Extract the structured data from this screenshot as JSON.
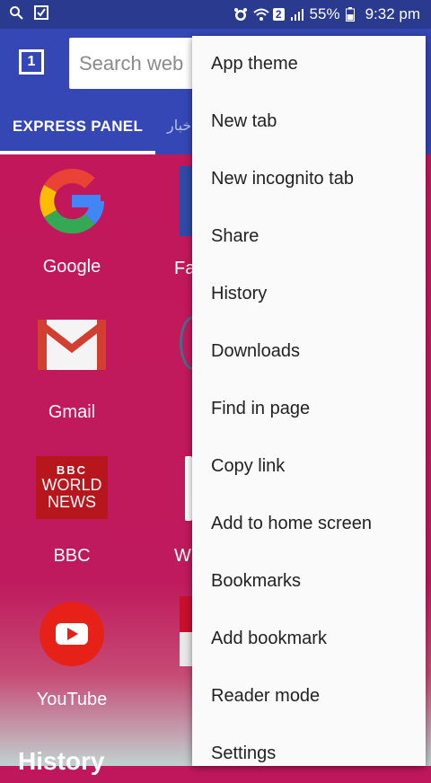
{
  "status_bar": {
    "battery": "55%",
    "time": "9:32 pm",
    "sim_badge": "2"
  },
  "toolbar": {
    "tab_count": "1",
    "search_placeholder": "Search web"
  },
  "tabs": {
    "active": "EXPRESS PANEL",
    "second": "أخبار"
  },
  "speed_dial": [
    {
      "label": "Google",
      "icon": "google-logo"
    },
    {
      "label": "Gmail",
      "icon": "gmail-logo"
    },
    {
      "label": "BBC",
      "icon": "bbc-world-news-logo",
      "logo_lines": [
        "BBC",
        "WORLD",
        "NEWS"
      ]
    },
    {
      "label": "YouTube",
      "icon": "youtube-logo"
    }
  ],
  "second_column_partial": [
    "Fa",
    "W"
  ],
  "section_heading": "History",
  "menu": {
    "items": [
      "App theme",
      "New tab",
      "New incognito tab",
      "Share",
      "History",
      "Downloads",
      "Find in page",
      "Copy link",
      "Add to home screen",
      "Bookmarks",
      "Add bookmark",
      "Reader mode",
      "Settings"
    ]
  },
  "colors": {
    "toolbar": "#3447b4",
    "status_bar": "#2a3a8f",
    "panel": "#c2185b"
  }
}
